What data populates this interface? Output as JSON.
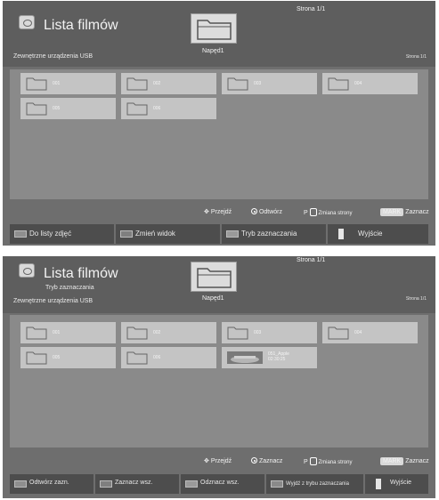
{
  "screen1": {
    "title": "Lista filmów",
    "device": "Zewnętrzne urządzenia USB",
    "page_top": "Strona 1/1",
    "drive": "Napęd1",
    "page_right": "Strona 1/1",
    "items": [
      "001",
      "002",
      "003",
      "004",
      "005",
      "006"
    ],
    "legend": {
      "move": "Przejdź",
      "action": "Odtwórz",
      "p": "P",
      "page_change": "Zmiana strony",
      "mark_key": "MARK",
      "mark": "Zaznacz"
    },
    "buttons": [
      "Do listy zdjęć",
      "Zmień widok",
      "Tryb zaznaczania",
      "Wyjście"
    ]
  },
  "screen2": {
    "title": "Lista filmów",
    "subtitle": "Tryb zaznaczania",
    "device": "Zewnętrzne urządzenia USB",
    "page_top": "Strona 1/1",
    "drive": "Napęd1",
    "page_right": "Strona 1/1",
    "items": [
      "001",
      "002",
      "003",
      "004",
      "005",
      "006"
    ],
    "file_item": {
      "name": "051_Apple",
      "time": "02:30:25"
    },
    "legend": {
      "move": "Przejdź",
      "action": "Zaznacz",
      "p": "P",
      "page_change": "Zmiana strony",
      "mark_key": "MARK",
      "mark": "Zaznacz"
    },
    "buttons": [
      "Odtwórz zazn.",
      "Zaznacz wsz.",
      "Odznacz wsz.",
      "Wyjdź z trybu zaznaczania",
      "Wyjście"
    ]
  },
  "icons": [
    "media-icon",
    "folder-icon",
    "navigate-arrows-icon",
    "ok-circle-icon",
    "page-updown-icon",
    "exit-icon"
  ]
}
